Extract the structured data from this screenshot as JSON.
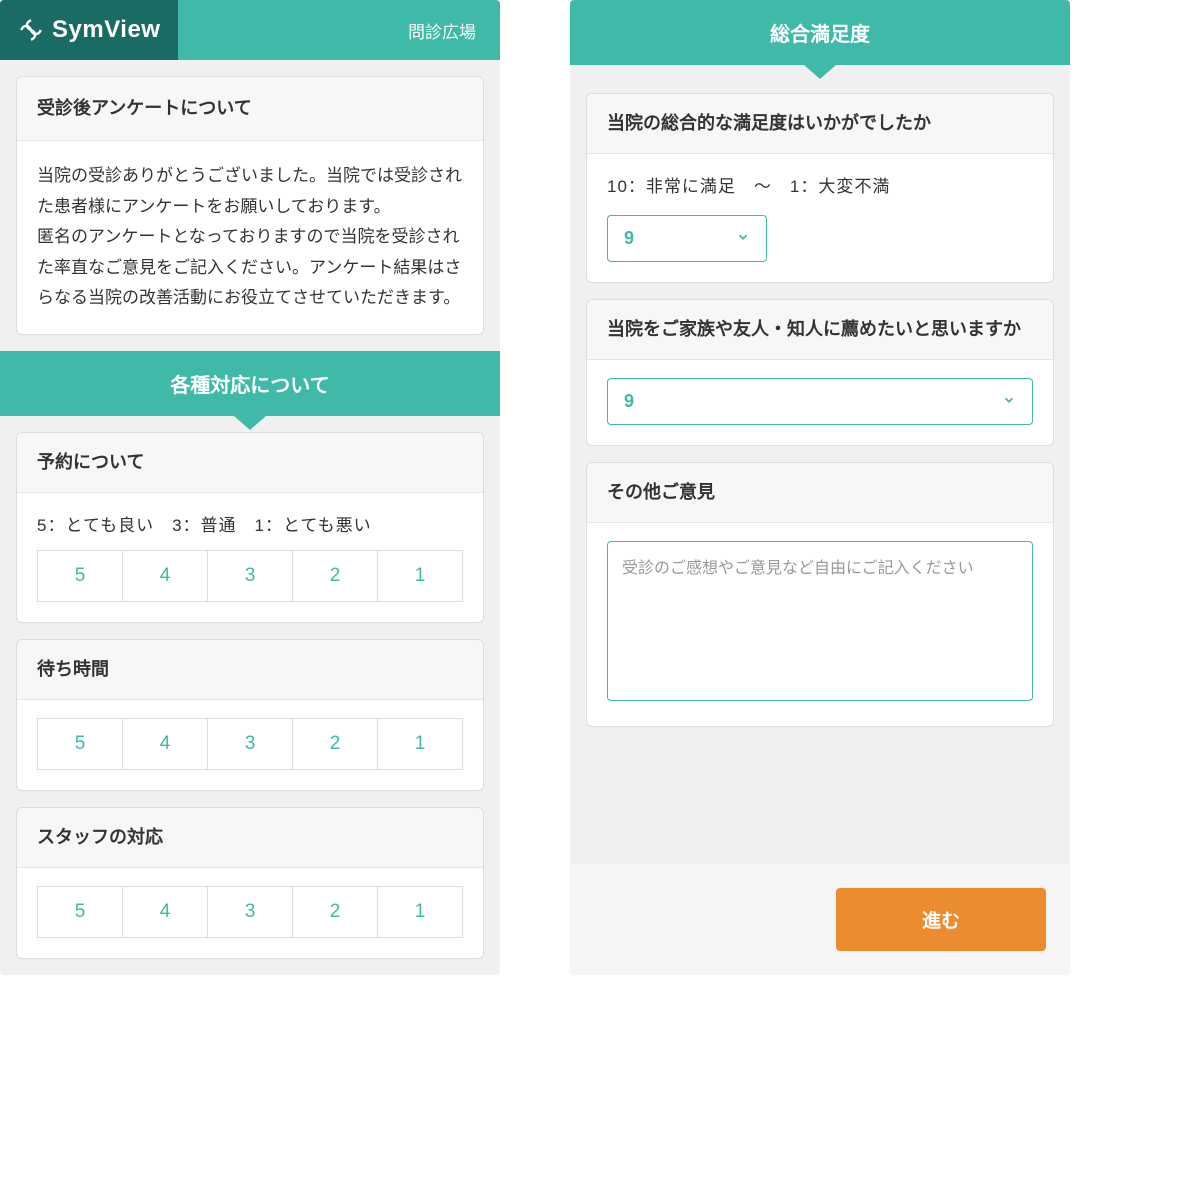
{
  "header": {
    "logo_text": "SymView",
    "right_label": "問診広場"
  },
  "intro": {
    "title": "受診後アンケートについて",
    "body": "当院の受診ありがとうございました。当院では受診された患者様にアンケートをお願いしております。\n匿名のアンケートとなっておりますので当院を受診された率直なご意見をご記入ください。アンケート結果はさらなる当院の改善活動にお役立てさせていただきます。"
  },
  "section1": {
    "title": "各種対応について",
    "scale_legend": "5：とても良い　3：普通　1：とても悪い",
    "questions": [
      {
        "title": "予約について"
      },
      {
        "title": "待ち時間"
      },
      {
        "title": "スタッフの対応"
      }
    ],
    "ratings": [
      "5",
      "4",
      "3",
      "2",
      "1"
    ]
  },
  "section2": {
    "title": "総合満足度",
    "q1": {
      "title": "当院の総合的な満足度はいかがでしたか",
      "legend": "10：非常に満足　〜　1：大変不満",
      "value": "9"
    },
    "q2": {
      "title": "当院をご家族や友人・知人に薦めたいと思いますか",
      "value": "9"
    },
    "q3": {
      "title": "その他ご意見",
      "placeholder": "受診のご感想やご意見など自由にご記入ください"
    }
  },
  "footer": {
    "proceed_label": "進む"
  }
}
